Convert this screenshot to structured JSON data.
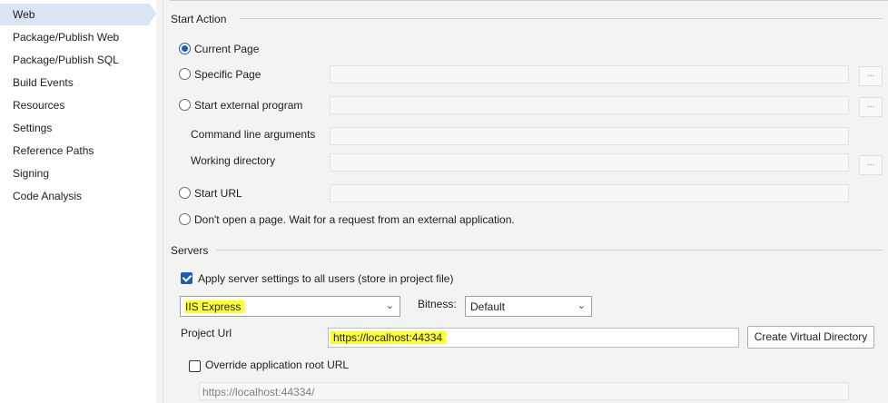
{
  "sidebar": {
    "items": [
      {
        "label": "Web",
        "selected": true
      },
      {
        "label": "Package/Publish Web"
      },
      {
        "label": "Package/Publish SQL"
      },
      {
        "label": "Build Events"
      },
      {
        "label": "Resources"
      },
      {
        "label": "Settings"
      },
      {
        "label": "Reference Paths"
      },
      {
        "label": "Signing"
      },
      {
        "label": "Code Analysis"
      }
    ]
  },
  "start_action": {
    "title": "Start Action",
    "current_page": "Current Page",
    "specific_page": "Specific Page",
    "start_external": "Start external program",
    "command_line": "Command line arguments",
    "working_dir": "Working directory",
    "start_url": "Start URL",
    "dont_open": "Don't open a page.  Wait for a request from an external application.",
    "selected": "current_page",
    "browse_label": "..."
  },
  "servers": {
    "title": "Servers",
    "apply_all": "Apply server settings to all users (store in project file)",
    "apply_all_checked": true,
    "server": "IIS Express",
    "bitness_label": "Bitness:",
    "bitness": "Default",
    "project_url_label": "Project Url",
    "project_url": "https://localhost:44334",
    "create_vdir": "Create Virtual Directory",
    "override_root": "Override application root URL",
    "override_root_checked": false,
    "root_url": "https://localhost:44334/"
  },
  "colors": {
    "accent": "#1a5fb4",
    "highlight": "#ffff33",
    "selected_nav": "#dae5f3"
  }
}
